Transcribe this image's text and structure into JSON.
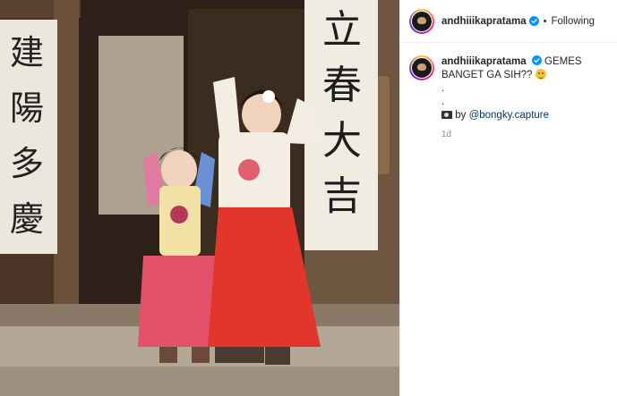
{
  "header": {
    "username": "andhiiikapratama",
    "separator": "•",
    "follow_state": "Following"
  },
  "caption": {
    "username": "andhiiikapratama",
    "text": "GEMES BANGET GA SIH??",
    "line2": ".",
    "line3": ".",
    "credit_prefix": "by",
    "mention": "@bongky.capture",
    "timestamp": "1d"
  },
  "photo": {
    "left_banner_text": "建陽多慶",
    "right_banner_text": "立春大吉"
  },
  "icons": {
    "verified": "verified-badge-icon",
    "emoji": "smiling-hearts-emoji-icon",
    "camera": "camera-icon"
  },
  "colors": {
    "verified_blue": "#0095f6",
    "mention_blue": "#00376b",
    "timestamp_gray": "#8e8e8e"
  }
}
